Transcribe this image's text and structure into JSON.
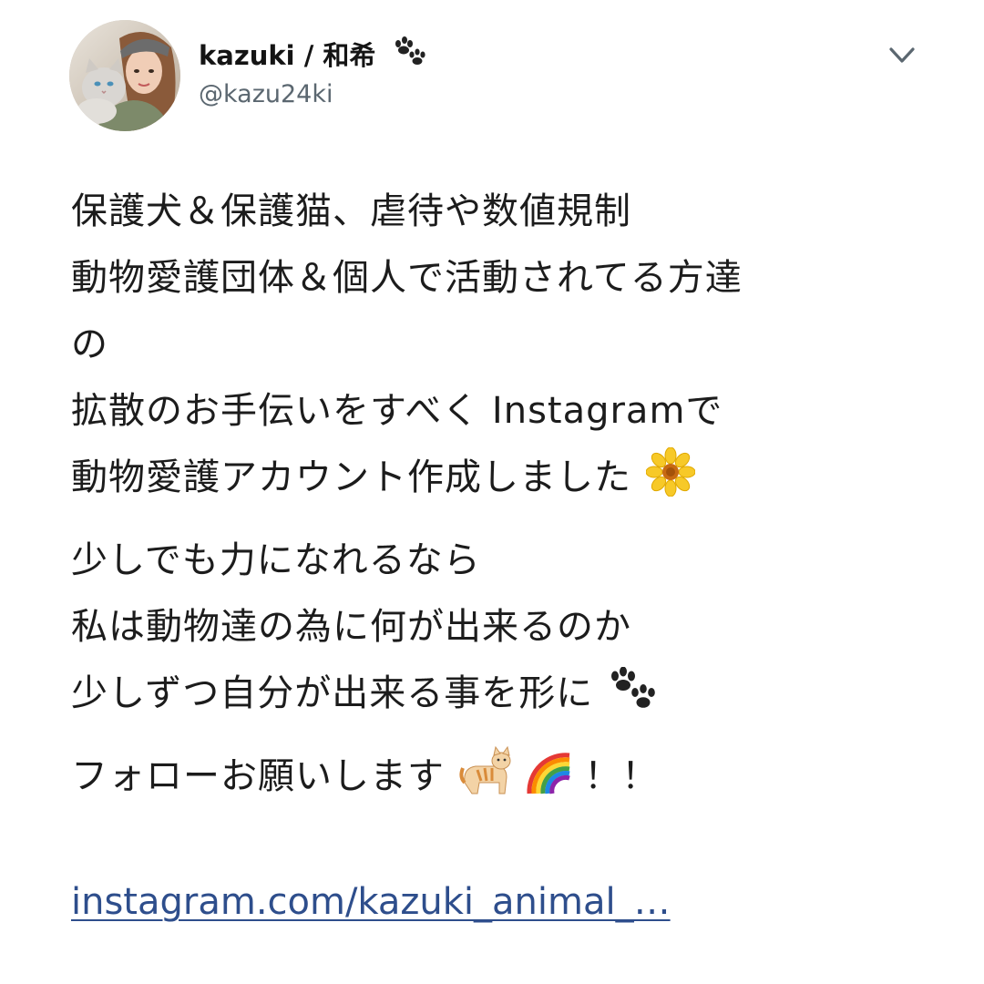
{
  "author": {
    "display_name": "kazuki / 和希",
    "handle": "@kazu24ki",
    "name_icon": "paw-prints-icon",
    "avatar_icon": "profile-photo-with-cat"
  },
  "menu": {
    "icon": "chevron-down-icon"
  },
  "tweet": {
    "lines": [
      "保護犬＆保護猫、虐待や数値規制",
      "動物愛護団体＆個人で活動されてる方達",
      "の",
      "拡散のお手伝いをすべく Instagramで",
      "動物愛護アカウント作成しました",
      "少しでも力になれるなら",
      "私は動物達の為に何が出来るのか",
      "少しずつ自分が出来る事を形に",
      "フォローお願いします",
      "！！"
    ],
    "emoji": {
      "flower": "sunflower-icon",
      "paws": "paw-prints-icon",
      "cat": "cat-icon",
      "rainbow": "rainbow-icon"
    },
    "link": "instagram.com/kazuki_animal_…"
  },
  "colors": {
    "text": "#1c1c1c",
    "handle": "#5b6770",
    "link": "#2e4e8c",
    "background": "#ffffff"
  }
}
